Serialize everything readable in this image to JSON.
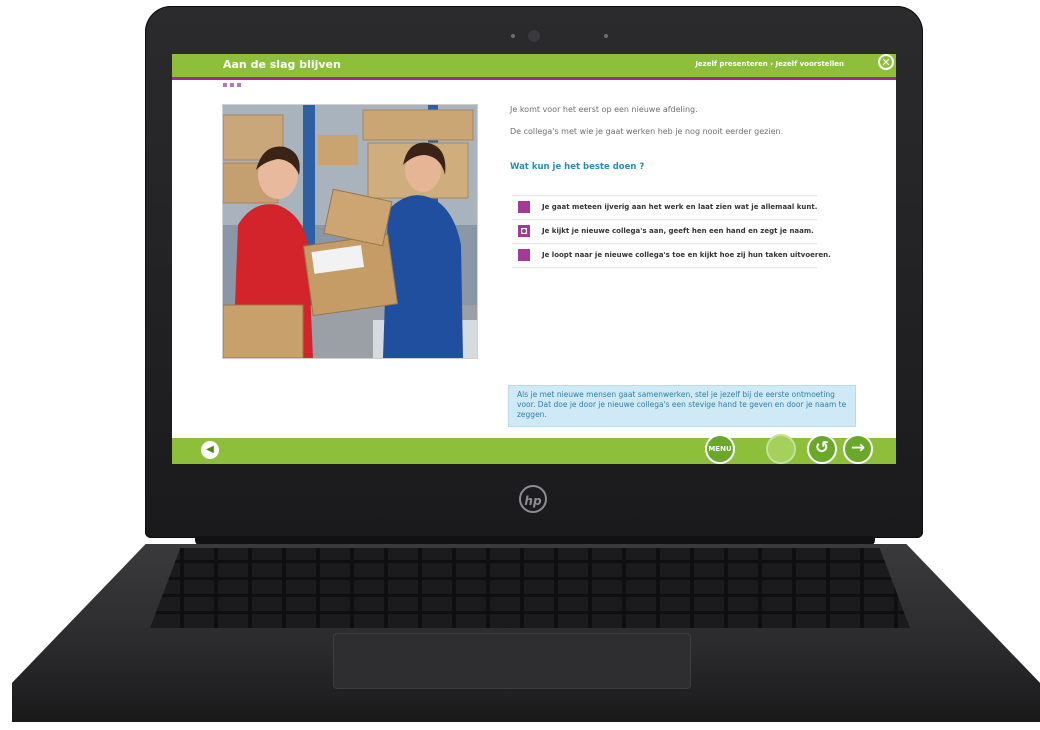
{
  "course": {
    "title": "Aan de slag blijven",
    "breadcrumb": "Jezelf presenteren › Jezelf voorstellen"
  },
  "content": {
    "intro_lines": [
      "Je komt voor het eerst op een nieuwe afdeling.",
      "De collega's met wie je gaat werken heb je nog nooit eerder gezien."
    ],
    "question": "Wat kun je het beste doen ?",
    "options": [
      {
        "label": "Je gaat meteen ijverig aan het werk en laat zien wat je allemaal kunt.",
        "selected": false
      },
      {
        "label": "Je kijkt je nieuwe collega's aan, geeft hen een hand en zegt je naam.",
        "selected": true
      },
      {
        "label": "Je loopt naar je nieuwe collega's toe en kijkt hoe zij hun taken uitvoeren.",
        "selected": false
      }
    ],
    "feedback": "Als je met nieuwe mensen gaat samenwerken, stel je jezelf bij de eerste ontmoeting voor. Dat doe je door je nieuwe collega's een stevige hand te geven en door je naam te zeggen."
  },
  "nav": {
    "menu_label": "MENU",
    "back_symbol": "↺",
    "next_symbol": "→",
    "close_symbol": "✕",
    "sound_symbol": "◀",
    "device_logo": "hp"
  },
  "colors": {
    "brand_green": "#8dbf3b",
    "accent_purple": "#a23a96",
    "question_blue": "#2a8bb5",
    "feedback_bg": "#cfeaf6"
  }
}
